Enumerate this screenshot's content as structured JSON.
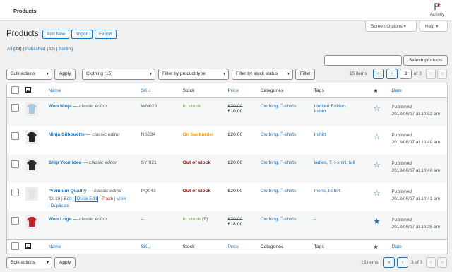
{
  "topbar": {
    "title": "Products",
    "activity": "Activity"
  },
  "screen_options": "Screen Options ▾",
  "help": "Help ▾",
  "page_title": "Products",
  "buttons": {
    "add_new": "Add New",
    "import": "Import",
    "export": "Export"
  },
  "views": {
    "all": "All",
    "all_count": "(33)",
    "published": "Published",
    "published_count": "(33)",
    "sorting": "Sorting",
    "sep": "|"
  },
  "search": {
    "button": "Search products"
  },
  "bulk_top": "Bulk actions",
  "apply": "Apply",
  "filters": {
    "category": "Clothing  (15)",
    "product_type": "Filter by product type",
    "stock_status": "Filter by stock status",
    "filter_button": "Filter"
  },
  "pagination": {
    "items": "15 items",
    "first": "«",
    "prev": "‹",
    "current": "3",
    "of": "of 3",
    "next": "›",
    "last": "»",
    "bottom_of": "3 of 3"
  },
  "columns": {
    "name": "Name",
    "sku": "SKU",
    "stock": "Stock",
    "price": "Price",
    "categories": "Categories",
    "tags": "Tags",
    "date": "Date"
  },
  "rows": [
    {
      "name": "Woo Ninja",
      "editor": "— classic editor",
      "sku": "WN023",
      "stock": "In stock",
      "stock_extra": "",
      "price_old": "£20.00",
      "price": "£10.00",
      "categories": "Clothing, T-shirts",
      "tags": "Limited Edition,",
      "tags2": "t-shirt",
      "featured": false,
      "status": "Published",
      "date": "2013/06/07 at 10:52 am",
      "shirt": "#a8c8de"
    },
    {
      "name": "Ninja Silhouette",
      "editor": "— classic editor",
      "sku": "NS034",
      "stock": "On backorder",
      "stock_extra": "",
      "price_old": "",
      "price": "£20.00",
      "categories": "Clothing, T-shirts",
      "tags": "t-shirt",
      "tags2": "",
      "featured": false,
      "status": "Published",
      "date": "2013/06/07 at 10:49 am",
      "shirt": "#222222"
    },
    {
      "name": "Ship Your Idea",
      "editor": "— classic editor",
      "sku": "SYI021",
      "stock": "Out of stock",
      "stock_extra": "",
      "price_old": "",
      "price": "£20.00",
      "categories": "Clothing, T-shirts",
      "tags": "ladies, T, t-shirt, tall",
      "tags2": "",
      "featured": false,
      "status": "Published",
      "date": "2013/06/07 at 10:46 am",
      "shirt": "#2a2a2a"
    },
    {
      "name": "Premium Quality",
      "editor": "— classic editor",
      "sku": "PQ043",
      "stock": "Out of stock",
      "stock_extra": "",
      "price_old": "",
      "price": "£20.00",
      "categories": "Clothing, T-shirts",
      "tags": "mens, t-shirt",
      "tags2": "",
      "featured": false,
      "status": "Published",
      "date": "2013/06/07 at 10:41 am",
      "shirt": "#e4e4e4",
      "row_actions": {
        "id": "ID: 19 |",
        "edit": "Edit",
        "sep1": "|",
        "quick_edit": "Quick Edit",
        "sep2": "|",
        "trash": "Trash",
        "sep3": "|",
        "view": "View",
        "sep4": "|",
        "duplicate": "Duplicate"
      }
    },
    {
      "name": "Woo Logo",
      "editor": "— classic editor",
      "sku": "–",
      "stock": "In stock",
      "stock_extra": "(5)",
      "price_old": "£20.00",
      "price": "£18.00",
      "categories": "Clothing, T-shirts",
      "tags": "–",
      "tags2": "",
      "featured": true,
      "status": "Published",
      "date": "2013/06/07 at 10:35 am",
      "shirt": "#c0262d"
    }
  ],
  "colors": {
    "link": "#2271b1",
    "in_stock": "#7ad03a",
    "backorder": "#eea000",
    "out_of_stock": "#aa0000",
    "trash": "#b32d2e",
    "star": "#2271b1"
  },
  "icons": {
    "image_column": "image-icon",
    "featured_column": "star-icon",
    "activity": "flag-icon"
  }
}
